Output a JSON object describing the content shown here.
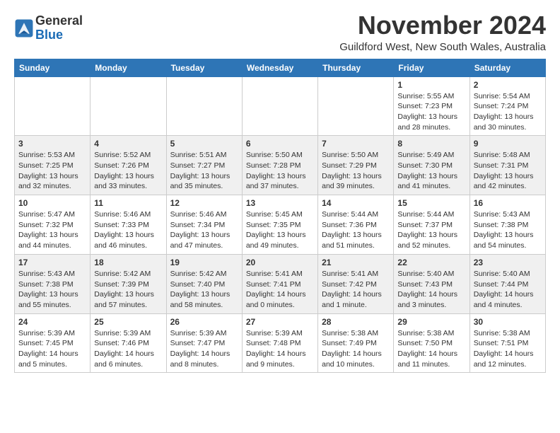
{
  "header": {
    "logo_general": "General",
    "logo_blue": "Blue",
    "month_title": "November 2024",
    "location": "Guildford West, New South Wales, Australia"
  },
  "calendar": {
    "days_of_week": [
      "Sunday",
      "Monday",
      "Tuesday",
      "Wednesday",
      "Thursday",
      "Friday",
      "Saturday"
    ],
    "weeks": [
      [
        {
          "day": "",
          "info": ""
        },
        {
          "day": "",
          "info": ""
        },
        {
          "day": "",
          "info": ""
        },
        {
          "day": "",
          "info": ""
        },
        {
          "day": "",
          "info": ""
        },
        {
          "day": "1",
          "info": "Sunrise: 5:55 AM\nSunset: 7:23 PM\nDaylight: 13 hours\nand 28 minutes."
        },
        {
          "day": "2",
          "info": "Sunrise: 5:54 AM\nSunset: 7:24 PM\nDaylight: 13 hours\nand 30 minutes."
        }
      ],
      [
        {
          "day": "3",
          "info": "Sunrise: 5:53 AM\nSunset: 7:25 PM\nDaylight: 13 hours\nand 32 minutes."
        },
        {
          "day": "4",
          "info": "Sunrise: 5:52 AM\nSunset: 7:26 PM\nDaylight: 13 hours\nand 33 minutes."
        },
        {
          "day": "5",
          "info": "Sunrise: 5:51 AM\nSunset: 7:27 PM\nDaylight: 13 hours\nand 35 minutes."
        },
        {
          "day": "6",
          "info": "Sunrise: 5:50 AM\nSunset: 7:28 PM\nDaylight: 13 hours\nand 37 minutes."
        },
        {
          "day": "7",
          "info": "Sunrise: 5:50 AM\nSunset: 7:29 PM\nDaylight: 13 hours\nand 39 minutes."
        },
        {
          "day": "8",
          "info": "Sunrise: 5:49 AM\nSunset: 7:30 PM\nDaylight: 13 hours\nand 41 minutes."
        },
        {
          "day": "9",
          "info": "Sunrise: 5:48 AM\nSunset: 7:31 PM\nDaylight: 13 hours\nand 42 minutes."
        }
      ],
      [
        {
          "day": "10",
          "info": "Sunrise: 5:47 AM\nSunset: 7:32 PM\nDaylight: 13 hours\nand 44 minutes."
        },
        {
          "day": "11",
          "info": "Sunrise: 5:46 AM\nSunset: 7:33 PM\nDaylight: 13 hours\nand 46 minutes."
        },
        {
          "day": "12",
          "info": "Sunrise: 5:46 AM\nSunset: 7:34 PM\nDaylight: 13 hours\nand 47 minutes."
        },
        {
          "day": "13",
          "info": "Sunrise: 5:45 AM\nSunset: 7:35 PM\nDaylight: 13 hours\nand 49 minutes."
        },
        {
          "day": "14",
          "info": "Sunrise: 5:44 AM\nSunset: 7:36 PM\nDaylight: 13 hours\nand 51 minutes."
        },
        {
          "day": "15",
          "info": "Sunrise: 5:44 AM\nSunset: 7:37 PM\nDaylight: 13 hours\nand 52 minutes."
        },
        {
          "day": "16",
          "info": "Sunrise: 5:43 AM\nSunset: 7:38 PM\nDaylight: 13 hours\nand 54 minutes."
        }
      ],
      [
        {
          "day": "17",
          "info": "Sunrise: 5:43 AM\nSunset: 7:38 PM\nDaylight: 13 hours\nand 55 minutes."
        },
        {
          "day": "18",
          "info": "Sunrise: 5:42 AM\nSunset: 7:39 PM\nDaylight: 13 hours\nand 57 minutes."
        },
        {
          "day": "19",
          "info": "Sunrise: 5:42 AM\nSunset: 7:40 PM\nDaylight: 13 hours\nand 58 minutes."
        },
        {
          "day": "20",
          "info": "Sunrise: 5:41 AM\nSunset: 7:41 PM\nDaylight: 14 hours\nand 0 minutes."
        },
        {
          "day": "21",
          "info": "Sunrise: 5:41 AM\nSunset: 7:42 PM\nDaylight: 14 hours\nand 1 minute."
        },
        {
          "day": "22",
          "info": "Sunrise: 5:40 AM\nSunset: 7:43 PM\nDaylight: 14 hours\nand 3 minutes."
        },
        {
          "day": "23",
          "info": "Sunrise: 5:40 AM\nSunset: 7:44 PM\nDaylight: 14 hours\nand 4 minutes."
        }
      ],
      [
        {
          "day": "24",
          "info": "Sunrise: 5:39 AM\nSunset: 7:45 PM\nDaylight: 14 hours\nand 5 minutes."
        },
        {
          "day": "25",
          "info": "Sunrise: 5:39 AM\nSunset: 7:46 PM\nDaylight: 14 hours\nand 6 minutes."
        },
        {
          "day": "26",
          "info": "Sunrise: 5:39 AM\nSunset: 7:47 PM\nDaylight: 14 hours\nand 8 minutes."
        },
        {
          "day": "27",
          "info": "Sunrise: 5:39 AM\nSunset: 7:48 PM\nDaylight: 14 hours\nand 9 minutes."
        },
        {
          "day": "28",
          "info": "Sunrise: 5:38 AM\nSunset: 7:49 PM\nDaylight: 14 hours\nand 10 minutes."
        },
        {
          "day": "29",
          "info": "Sunrise: 5:38 AM\nSunset: 7:50 PM\nDaylight: 14 hours\nand 11 minutes."
        },
        {
          "day": "30",
          "info": "Sunrise: 5:38 AM\nSunset: 7:51 PM\nDaylight: 14 hours\nand 12 minutes."
        }
      ]
    ]
  }
}
